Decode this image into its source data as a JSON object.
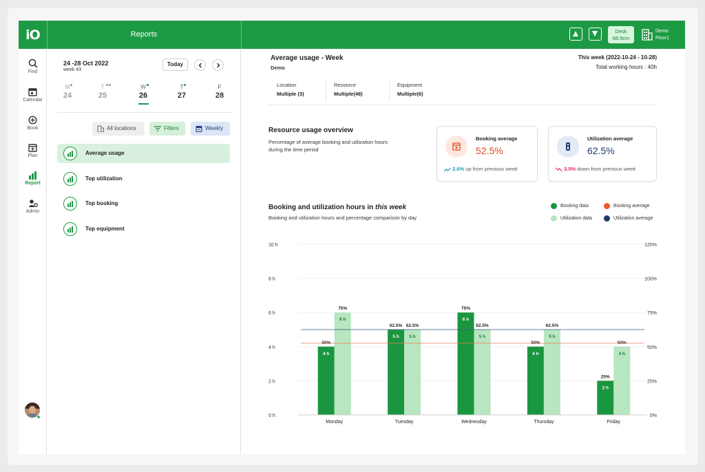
{
  "app": {
    "logo": "iO",
    "title": "Reports"
  },
  "topbar": {
    "desk_label": "Desk",
    "desk_size": "68.5cm",
    "location_line1": "Demo",
    "location_line2": "Floor1"
  },
  "rail": [
    {
      "label": "Find",
      "icon": "search-icon"
    },
    {
      "label": "Calendar",
      "icon": "calendar-icon"
    },
    {
      "label": "Book",
      "icon": "plus-circle-icon"
    },
    {
      "label": "Plan",
      "icon": "plan-icon"
    },
    {
      "label": "Report",
      "icon": "bar-chart-icon",
      "active": true
    },
    {
      "label": "Admin",
      "icon": "admin-icon"
    }
  ],
  "calendar": {
    "date_range": "24 -28 Oct 2022",
    "week": "week 43",
    "today_label": "Today",
    "days": [
      {
        "letter": "M",
        "num": "24"
      },
      {
        "letter": "T",
        "num": "25"
      },
      {
        "letter": "W",
        "num": "26"
      },
      {
        "letter": "T",
        "num": "27"
      },
      {
        "letter": "F",
        "num": "28"
      }
    ]
  },
  "filters": {
    "locations": "All locations",
    "filters": "Filters",
    "period": "Weekly"
  },
  "reports": [
    {
      "label": "Average usage",
      "active": true
    },
    {
      "label": "Top utilization"
    },
    {
      "label": "Top booking"
    },
    {
      "label": "Top equipment"
    }
  ],
  "header": {
    "title": "Average usage - Week",
    "subtitle": "Demo",
    "week_range": "This week (2022-10-24 - 10-28)",
    "total_hours": "Total working hours : 40h"
  },
  "info": {
    "location_label": "Location",
    "location_value": "Multiple (3)",
    "resource_label": "Resource",
    "resource_value": "Multiple(48)",
    "equipment_label": "Equipment",
    "equipment_value": "Multiple(6)"
  },
  "overview": {
    "title": "Resource usage overview",
    "description": "Percentage of average booking and utilization hours during the time period"
  },
  "cards": {
    "booking": {
      "title": "Booking average",
      "value": "52.5%",
      "delta": "2.6%",
      "direction": "up from previous",
      "period": "week",
      "color": "#e04a1f"
    },
    "utilization": {
      "title": "Utilization average",
      "value": "62.5%",
      "delta": "3.5%",
      "direction": "down from previous",
      "period": "week",
      "color": "#1e3a6e"
    }
  },
  "chart_section": {
    "title": "Booking and utilization hours in",
    "title_italic": "this week",
    "subtitle": "Booking and utilization hours and percentage comparison by day",
    "legend": {
      "booking_data": "Booking data",
      "utilization_data": "Utilization data",
      "booking_average": "Booking average",
      "utilization_average": "Utilization average"
    }
  },
  "chart_data": {
    "type": "bar",
    "categories": [
      "Monday",
      "Tuesday",
      "Wednesday",
      "Thursday",
      "Friday"
    ],
    "series": [
      {
        "name": "Booking data",
        "values": [
          4,
          5,
          6,
          4,
          2
        ],
        "labels": [
          "4 h",
          "5 h",
          "6 h",
          "4 h",
          "2 h"
        ],
        "percent_labels": [
          "50%",
          "62.5%",
          "75%",
          "50%",
          "25%"
        ],
        "color": "#1b9640"
      },
      {
        "name": "Utilization data",
        "values": [
          6,
          5,
          5,
          5,
          4
        ],
        "labels": [
          "6 h",
          "5 h",
          "5 h",
          "5 h",
          "4 h"
        ],
        "percent_labels": [
          "75%",
          "62.5%",
          "62.5%",
          "62.5%",
          "50%"
        ],
        "color": "#b7e6c0"
      }
    ],
    "booking_average": 52.5,
    "utilization_average": 62.5,
    "average_colors": {
      "booking": "#ee7a55",
      "utilization": "#3a557f"
    },
    "ylim": [
      0,
      10
    ],
    "yticks": [
      "0 h",
      "2 h",
      "4 h",
      "6 h",
      "8 h",
      "10 h"
    ],
    "y2lim": [
      0,
      125
    ],
    "y2ticks": [
      "0%",
      "25%",
      "50%",
      "75%",
      "100%",
      "125%"
    ]
  }
}
